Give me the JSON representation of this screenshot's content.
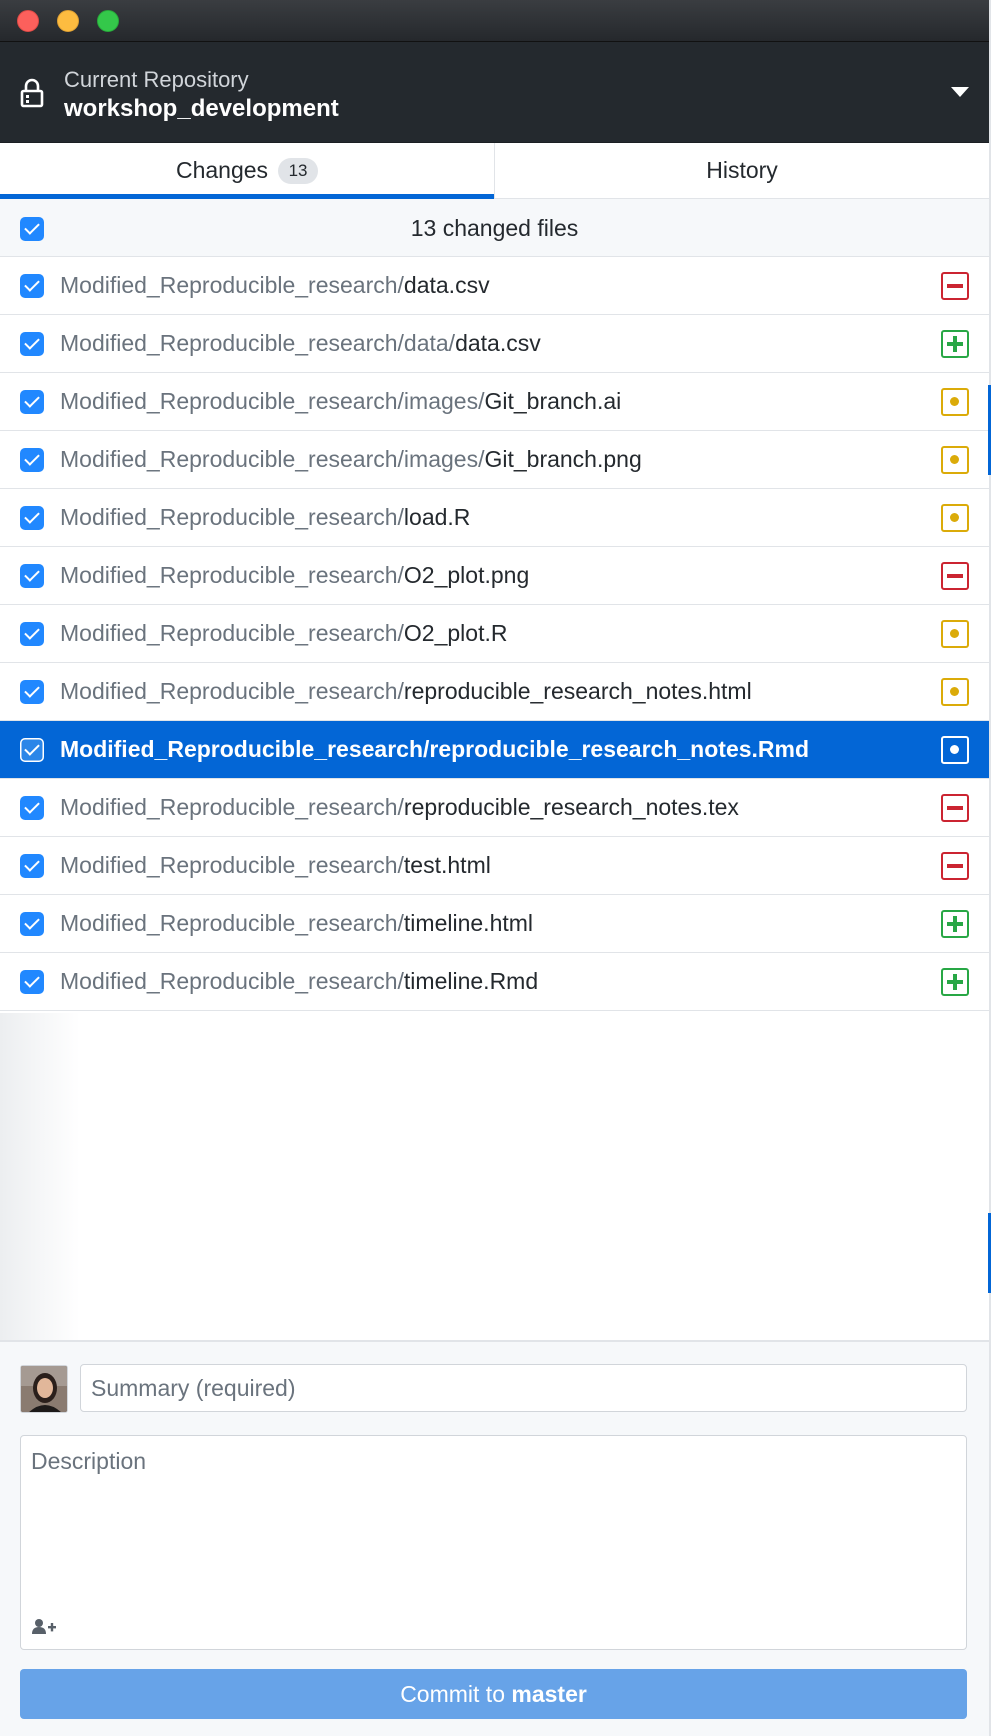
{
  "repository": {
    "caption": "Current Repository",
    "name": "workshop_development"
  },
  "tabs": [
    {
      "label": "Changes",
      "count": "13",
      "active": true
    },
    {
      "label": "History",
      "active": false
    }
  ],
  "changes": {
    "summary_text": "13 changed files",
    "all_checked": true,
    "files": [
      {
        "dir": "Modified_Reproducible_research/",
        "name": "data.csv",
        "status": "deleted",
        "checked": true
      },
      {
        "dir": "Modified_Reproducible_research/data/",
        "name": "data.csv",
        "status": "added",
        "checked": true
      },
      {
        "dir": "Modified_Reproducible_research/images/",
        "name": "Git_branch.ai",
        "status": "modified",
        "checked": true
      },
      {
        "dir": "Modified_Reproducible_research/images/",
        "name": "Git_branch.png",
        "status": "modified",
        "checked": true
      },
      {
        "dir": "Modified_Reproducible_research/",
        "name": "load.R",
        "status": "modified",
        "checked": true
      },
      {
        "dir": "Modified_Reproducible_research/",
        "name": "O2_plot.png",
        "status": "deleted",
        "checked": true
      },
      {
        "dir": "Modified_Reproducible_research/",
        "name": "O2_plot.R",
        "status": "modified",
        "checked": true
      },
      {
        "dir": "Modified_Reproducible_research/",
        "name": "reproducible_research_notes.html",
        "status": "modified",
        "checked": true
      },
      {
        "dir": "Modified_Reproducible_research/",
        "name": "reproducible_research_notes.Rmd",
        "status": "modified",
        "checked": true,
        "selected": true
      },
      {
        "dir": "Modified_Reproducible_research/",
        "name": "reproducible_research_notes.tex",
        "status": "deleted",
        "checked": true
      },
      {
        "dir": "Modified_Reproducible_research/",
        "name": "test.html",
        "status": "deleted",
        "checked": true
      },
      {
        "dir": "Modified_Reproducible_research/",
        "name": "timeline.html",
        "status": "added",
        "checked": true
      },
      {
        "dir": "Modified_Reproducible_research/",
        "name": "timeline.Rmd",
        "status": "added",
        "checked": true
      }
    ]
  },
  "commit": {
    "summary_placeholder": "Summary (required)",
    "summary_value": "",
    "description_placeholder": "Description",
    "description_value": "",
    "button_prefix": "Commit to ",
    "branch": "master"
  },
  "colors": {
    "accent": "#0366d6",
    "deleted": "#cb2431",
    "added": "#28a745",
    "modified": "#dbab09",
    "header_bg": "#24292e"
  },
  "icons": {
    "lock": "lock-icon",
    "caret": "chevron-down-icon",
    "deleted": "diff-removed-icon",
    "added": "diff-added-icon",
    "modified": "diff-modified-icon",
    "coauthor": "add-coauthor-icon"
  }
}
